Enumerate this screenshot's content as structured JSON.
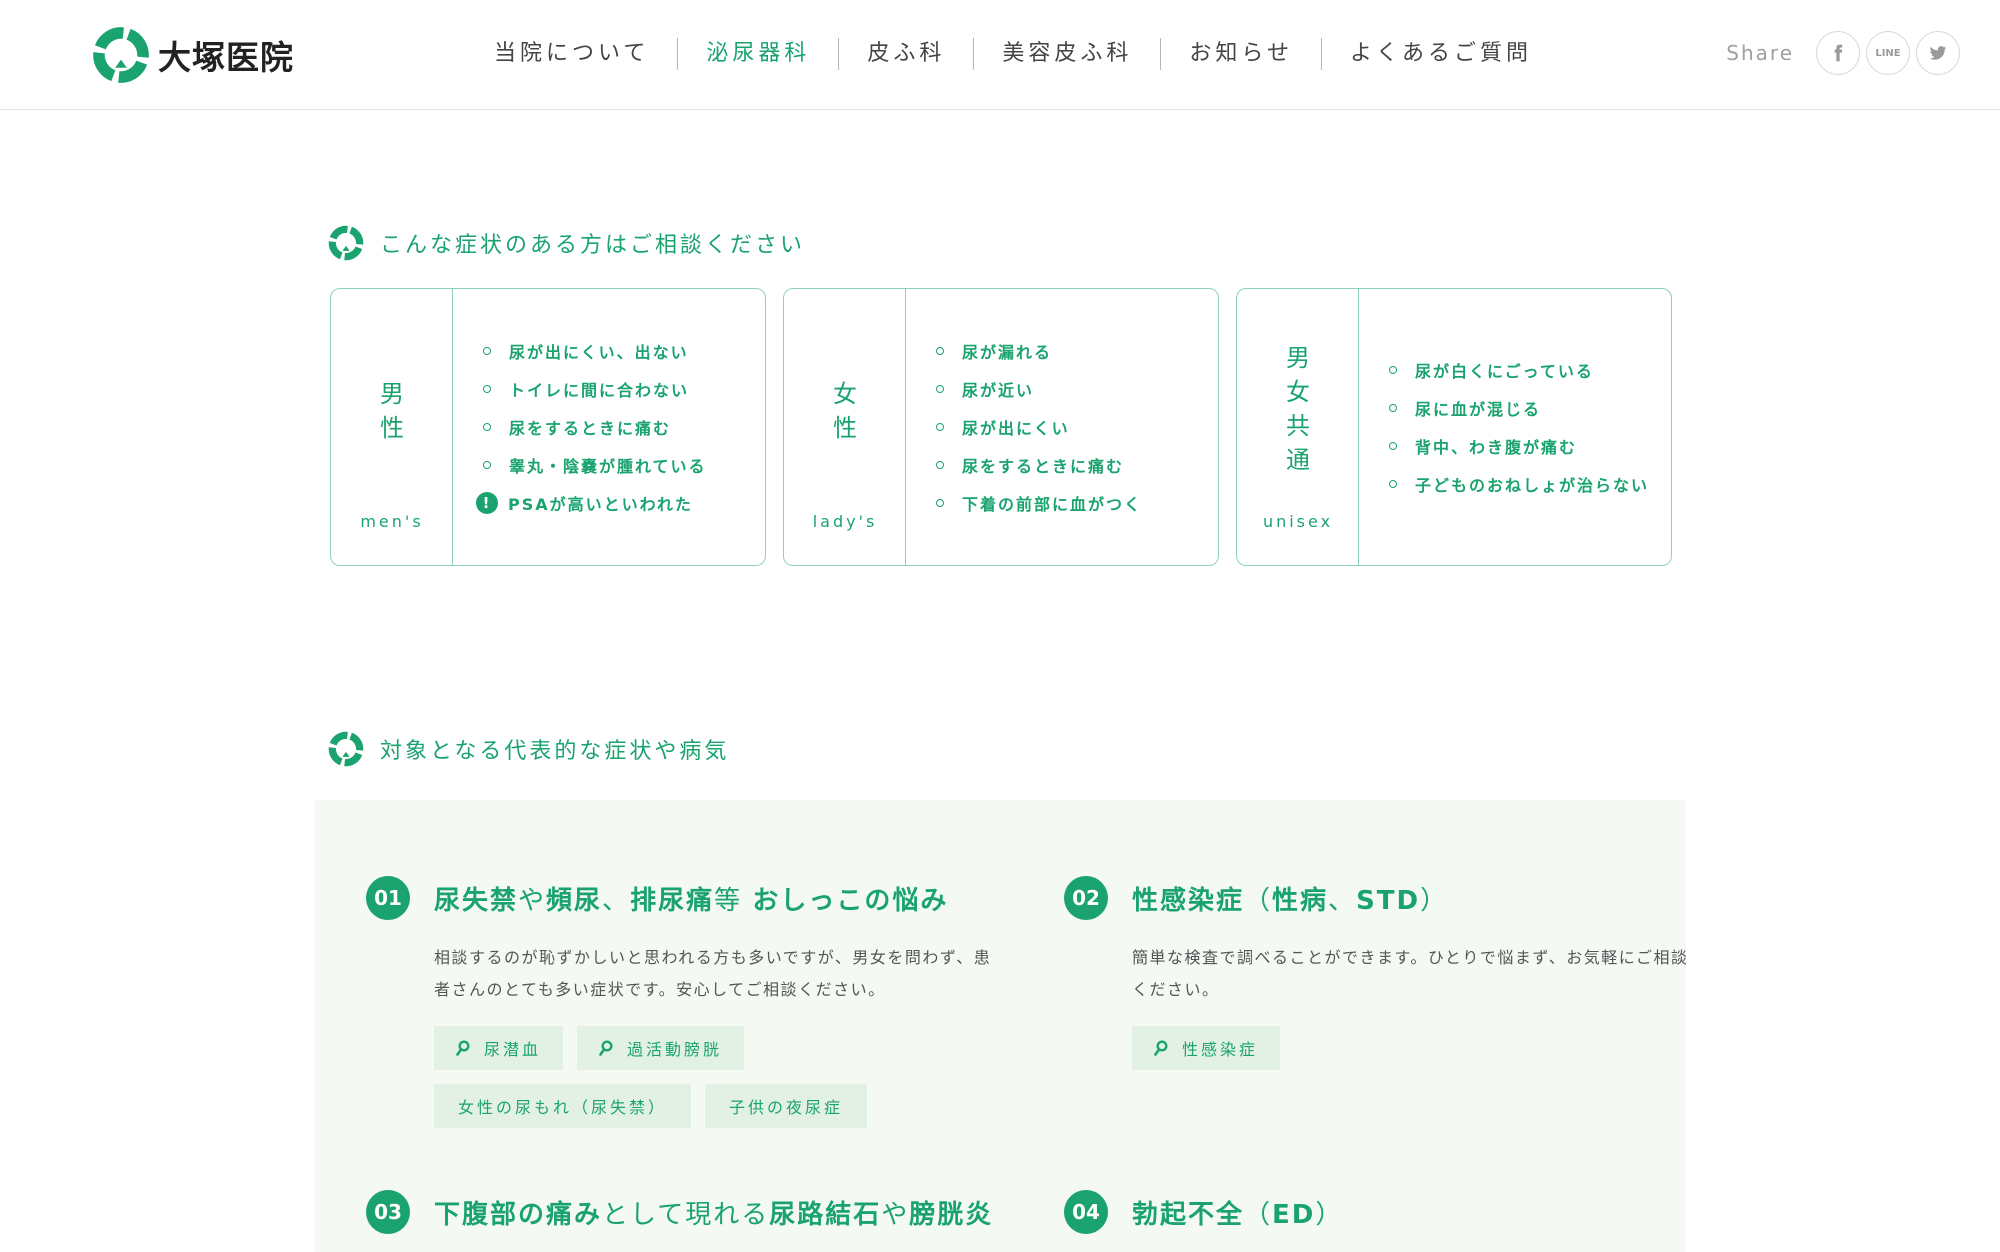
{
  "header": {
    "logo_text": "大塚医院",
    "nav": [
      "当院について",
      "泌尿器科",
      "皮ふ科",
      "美容皮ふ科",
      "お知らせ",
      "よくあるご質問"
    ],
    "active_nav": 1,
    "share_label": "Share",
    "share_line": "LINE"
  },
  "section1": {
    "title": "こんな症状のある方はご相談ください",
    "cards": [
      {
        "kanji": [
          "男",
          "性"
        ],
        "en": "men's",
        "items": [
          "尿が出にくい、出ない",
          "トイレに間に合わない",
          "尿をするときに痛む",
          "睾丸・陰嚢が腫れている"
        ],
        "warning": "PSAが高いといわれた"
      },
      {
        "kanji": [
          "女",
          "性"
        ],
        "en": "lady's",
        "items": [
          "尿が漏れる",
          "尿が近い",
          "尿が出にくい",
          "尿をするときに痛む",
          "下着の前部に血がつく"
        ]
      },
      {
        "kanji": [
          "男",
          "女",
          "共",
          "通"
        ],
        "en": "unisex",
        "items": [
          "尿が白くにごっている",
          "尿に血が混じる",
          "背中、わき腹が痛む",
          "子どものおねしょが治らない"
        ]
      }
    ]
  },
  "section2": {
    "title": "対象となる代表的な症状や病気",
    "diseases": [
      {
        "num": "01",
        "title_parts": [
          {
            "text": "尿失禁",
            "bold": true
          },
          {
            "text": "や",
            "bold": false
          },
          {
            "text": "頻尿",
            "bold": true
          },
          {
            "text": "、",
            "bold": false
          },
          {
            "text": "排尿痛",
            "bold": true
          },
          {
            "text": "等 ",
            "bold": false
          },
          {
            "text": "おしっこの悩み",
            "bold": true
          }
        ],
        "desc": "相談するのが恥ずかしいと思われる方も多いですが、男女を問わず、患者さんのとても多い症状です。安心してご相談ください。",
        "tags": [
          {
            "label": "尿潜血",
            "search": true
          },
          {
            "label": "過活動膀胱",
            "search": true
          },
          {
            "label": "女性の尿もれ（尿失禁）",
            "search": false
          },
          {
            "label": "子供の夜尿症",
            "search": false
          }
        ]
      },
      {
        "num": "02",
        "title_parts": [
          {
            "text": "性感染症",
            "bold": true
          },
          {
            "text": "（",
            "bold": false
          },
          {
            "text": "性病",
            "bold": true
          },
          {
            "text": "、",
            "bold": false
          },
          {
            "text": "STD",
            "bold": true
          },
          {
            "text": "）",
            "bold": false
          }
        ],
        "desc": "簡単な検査で調べることができます。ひとりで悩まず、お気軽にご相談ください。",
        "tags": [
          {
            "label": "性感染症",
            "search": true
          }
        ]
      },
      {
        "num": "03",
        "title_parts": [
          {
            "text": "下腹部の痛み",
            "bold": true
          },
          {
            "text": "として現れる",
            "bold": false
          },
          {
            "text": "尿路結石",
            "bold": true
          },
          {
            "text": "や",
            "bold": false
          },
          {
            "text": "膀胱炎",
            "bold": true
          }
        ]
      },
      {
        "num": "04",
        "title_parts": [
          {
            "text": "勃起不全",
            "bold": true
          },
          {
            "text": "（",
            "bold": false
          },
          {
            "text": "ED",
            "bold": true
          },
          {
            "text": "）",
            "bold": false
          }
        ]
      }
    ]
  },
  "colors": {
    "accent": "#1aa36f",
    "card_border": "#8fd3b5",
    "panel_bg": "#f4f9f4",
    "tag_bg": "#e3f1e5"
  }
}
